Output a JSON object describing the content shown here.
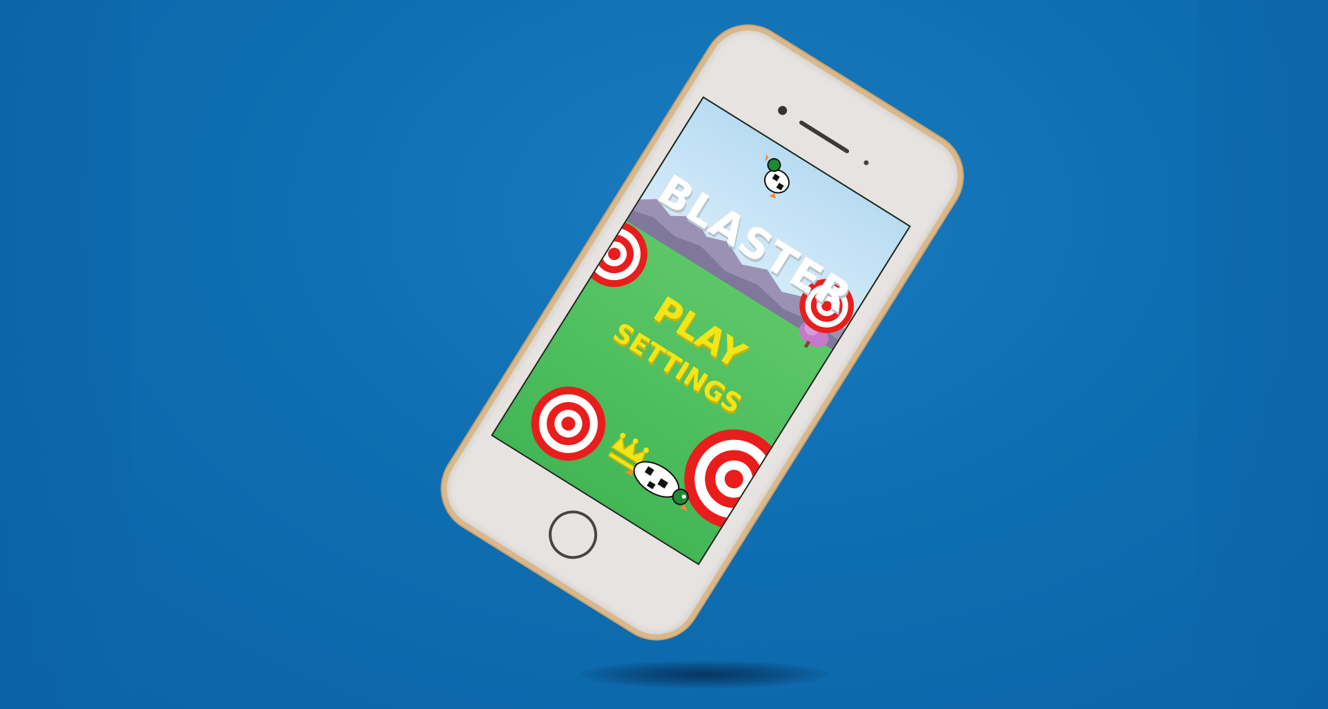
{
  "scene": {
    "background_color": "#0e6eb1",
    "phone_frame_color": "#e6e3e1",
    "phone_edge_color": "#d9b98c"
  },
  "game": {
    "title": "BLASTER",
    "menu": {
      "play_label": "PLAY",
      "settings_label": "SETTINGS"
    },
    "colors": {
      "target_red": "#ea1d1d",
      "target_white": "#ffffff",
      "menu_yellow": "#f3e516",
      "grass_green": "#4cc05c",
      "sky_blue": "#c6e3f6",
      "mountain_purple": "#9a91b4",
      "tree_pink": "#c47ac9"
    },
    "icons": [
      "duck-icon",
      "target-icon",
      "crown-icon",
      "tree-icon"
    ]
  }
}
